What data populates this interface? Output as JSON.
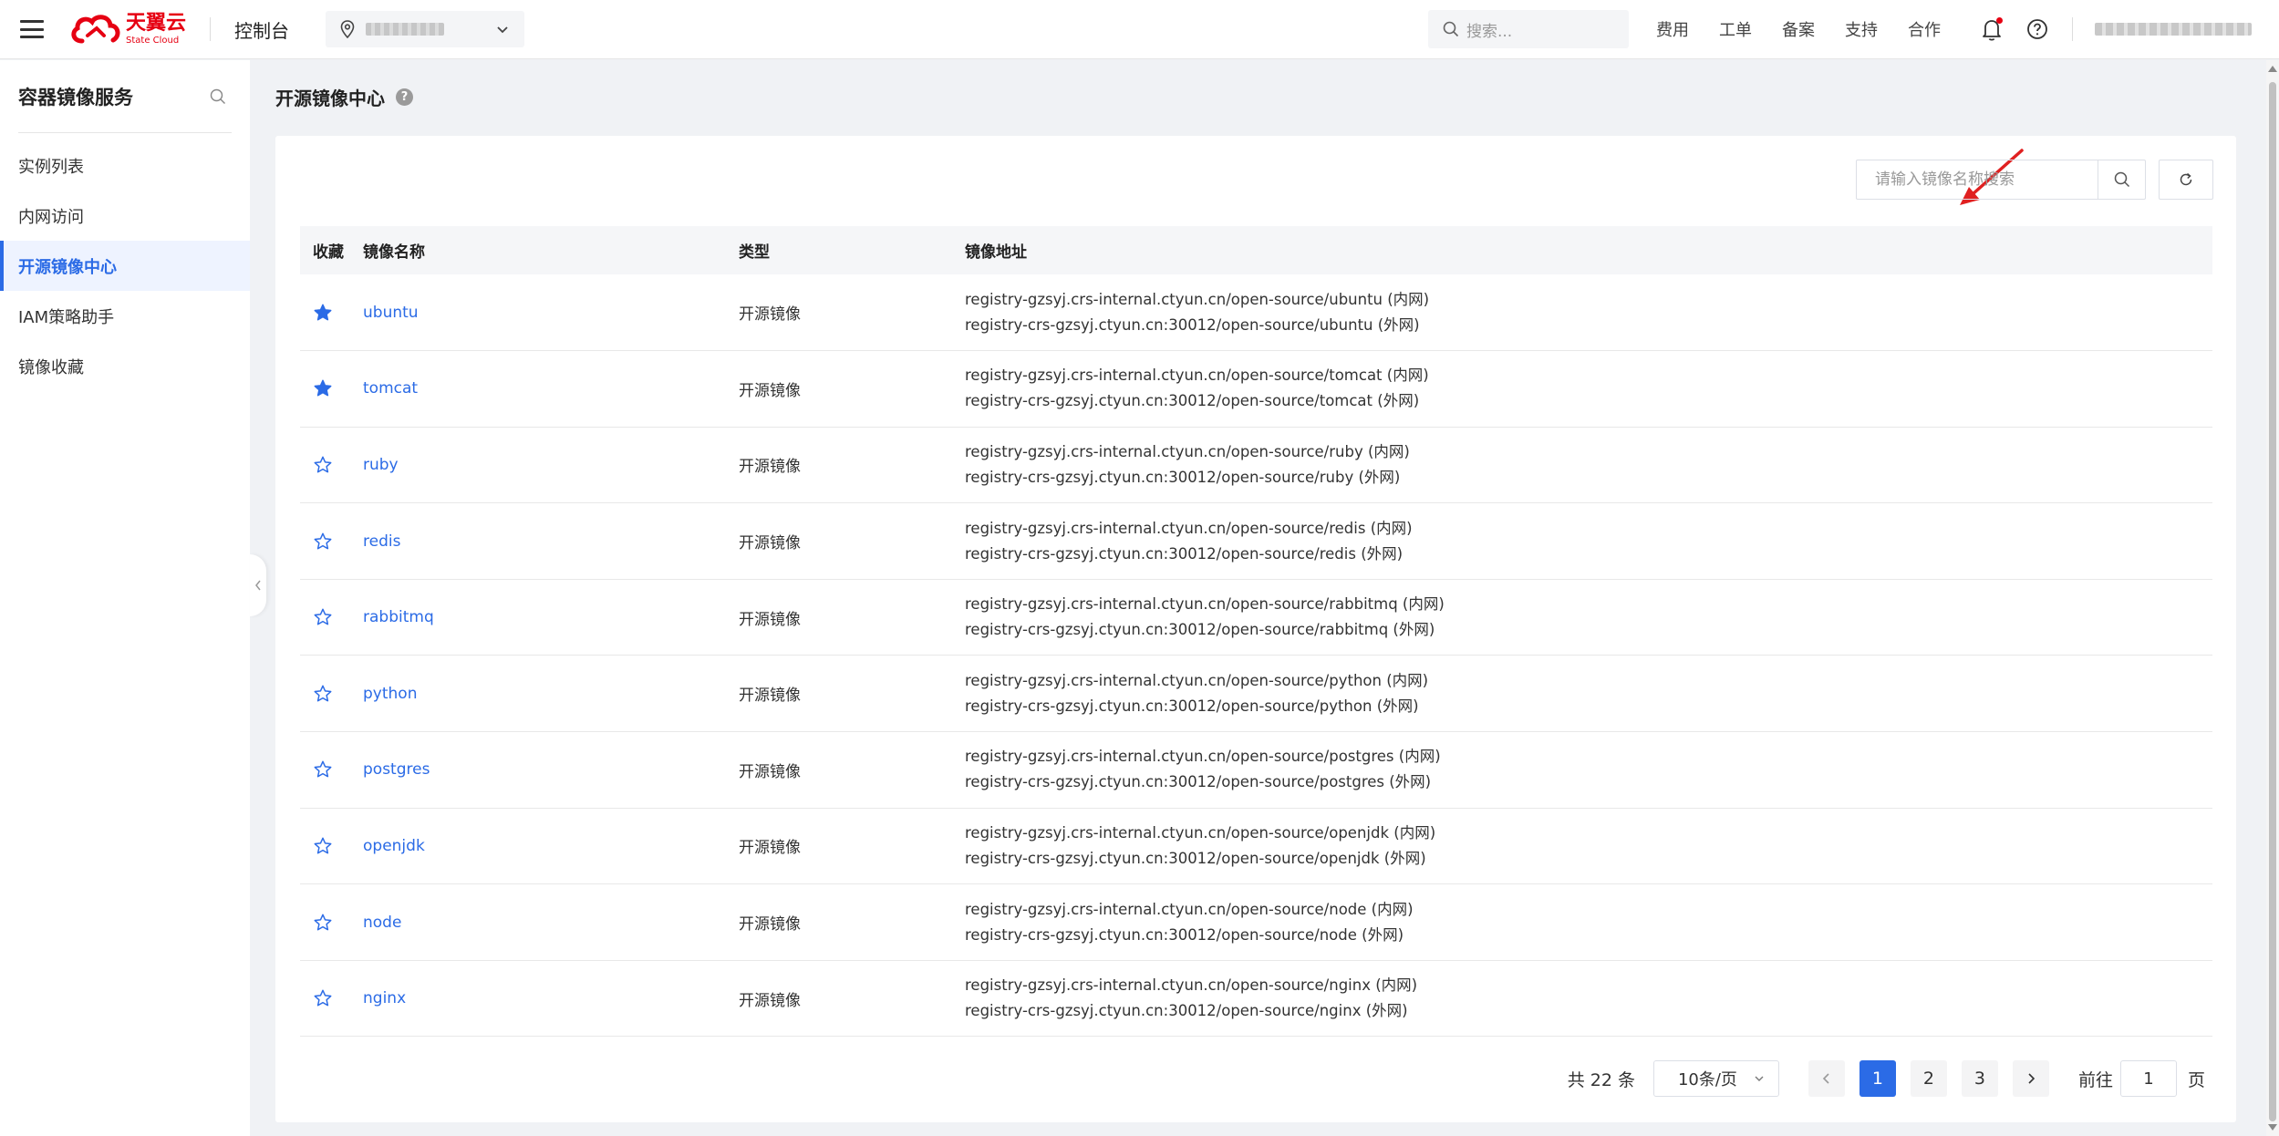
{
  "header": {
    "logo_cn": "天翼云",
    "logo_en": "State Cloud",
    "console_label": "控制台",
    "search_placeholder": "搜索...",
    "nav_links": [
      "费用",
      "工单",
      "备案",
      "支持",
      "合作"
    ]
  },
  "sidebar": {
    "title": "容器镜像服务",
    "items": [
      {
        "label": "实例列表",
        "active": false
      },
      {
        "label": "内网访问",
        "active": false
      },
      {
        "label": "开源镜像中心",
        "active": true
      },
      {
        "label": "IAM策略助手",
        "active": false
      },
      {
        "label": "镜像收藏",
        "active": false
      }
    ]
  },
  "main": {
    "page_title": "开源镜像中心",
    "help_glyph": "?",
    "search_placeholder": "请输入镜像名称搜索",
    "columns": [
      "收藏",
      "镜像名称",
      "类型",
      "镜像地址"
    ],
    "rows": [
      {
        "favorited": true,
        "name": "ubuntu",
        "type": "开源镜像",
        "addr_internal": "registry-gzsyj.crs-internal.ctyun.cn/open-source/ubuntu (内网)",
        "addr_external": "registry-crs-gzsyj.ctyun.cn:30012/open-source/ubuntu (外网)"
      },
      {
        "favorited": true,
        "name": "tomcat",
        "type": "开源镜像",
        "addr_internal": "registry-gzsyj.crs-internal.ctyun.cn/open-source/tomcat (内网)",
        "addr_external": "registry-crs-gzsyj.ctyun.cn:30012/open-source/tomcat (外网)"
      },
      {
        "favorited": false,
        "name": "ruby",
        "type": "开源镜像",
        "addr_internal": "registry-gzsyj.crs-internal.ctyun.cn/open-source/ruby (内网)",
        "addr_external": "registry-crs-gzsyj.ctyun.cn:30012/open-source/ruby (外网)"
      },
      {
        "favorited": false,
        "name": "redis",
        "type": "开源镜像",
        "addr_internal": "registry-gzsyj.crs-internal.ctyun.cn/open-source/redis (内网)",
        "addr_external": "registry-crs-gzsyj.ctyun.cn:30012/open-source/redis (外网)"
      },
      {
        "favorited": false,
        "name": "rabbitmq",
        "type": "开源镜像",
        "addr_internal": "registry-gzsyj.crs-internal.ctyun.cn/open-source/rabbitmq (内网)",
        "addr_external": "registry-crs-gzsyj.ctyun.cn:30012/open-source/rabbitmq (外网)"
      },
      {
        "favorited": false,
        "name": "python",
        "type": "开源镜像",
        "addr_internal": "registry-gzsyj.crs-internal.ctyun.cn/open-source/python (内网)",
        "addr_external": "registry-crs-gzsyj.ctyun.cn:30012/open-source/python (外网)"
      },
      {
        "favorited": false,
        "name": "postgres",
        "type": "开源镜像",
        "addr_internal": "registry-gzsyj.crs-internal.ctyun.cn/open-source/postgres (内网)",
        "addr_external": "registry-crs-gzsyj.ctyun.cn:30012/open-source/postgres (外网)"
      },
      {
        "favorited": false,
        "name": "openjdk",
        "type": "开源镜像",
        "addr_internal": "registry-gzsyj.crs-internal.ctyun.cn/open-source/openjdk (内网)",
        "addr_external": "registry-crs-gzsyj.ctyun.cn:30012/open-source/openjdk (外网)"
      },
      {
        "favorited": false,
        "name": "node",
        "type": "开源镜像",
        "addr_internal": "registry-gzsyj.crs-internal.ctyun.cn/open-source/node (内网)",
        "addr_external": "registry-crs-gzsyj.ctyun.cn:30012/open-source/node (外网)"
      },
      {
        "favorited": false,
        "name": "nginx",
        "type": "开源镜像",
        "addr_internal": "registry-gzsyj.crs-internal.ctyun.cn/open-source/nginx (内网)",
        "addr_external": "registry-crs-gzsyj.ctyun.cn:30012/open-source/nginx (外网)"
      }
    ],
    "pagination": {
      "total_label": "共 22 条",
      "page_size": "10条/页",
      "pages": [
        "1",
        "2",
        "3"
      ],
      "current_page": "1",
      "jump_label": "前往",
      "jump_value": "1",
      "jump_suffix": "页"
    }
  },
  "colors": {
    "accent": "#2b6be6",
    "brand_red": "#e60012",
    "annotation_arrow": "#e02020"
  },
  "icons": [
    "menu-icon",
    "location-pin-icon",
    "chevron-down-icon",
    "search-icon",
    "bell-icon",
    "help-icon",
    "star-icon",
    "refresh-icon",
    "chevron-left-icon",
    "chevron-right-icon"
  ]
}
